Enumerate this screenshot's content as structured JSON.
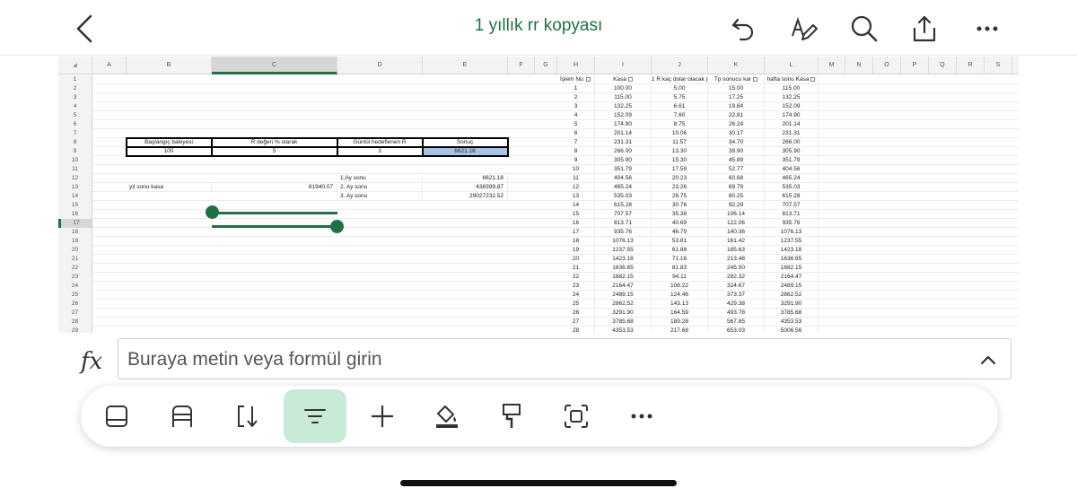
{
  "header": {
    "title": "1 yıllık rr kopyası",
    "back_icon": "chevron-left-icon",
    "undo_icon": "undo-icon",
    "pen_icon": "draw-pen-icon",
    "search_icon": "search-icon",
    "share_icon": "share-icon",
    "more_icon": "more-horizontal-icon"
  },
  "colors": {
    "accent": "#1e7145",
    "active_tool_bg": "#c9ead6",
    "highlight_cell": "#a8c3e8"
  },
  "sheet": {
    "corner": "◢",
    "columns": [
      "A",
      "B",
      "C",
      "D",
      "E",
      "F",
      "G",
      "H",
      "I",
      "J",
      "K",
      "L",
      "M",
      "N",
      "O",
      "P",
      "Q",
      "R",
      "S"
    ],
    "rows": [
      "1",
      "2",
      "3",
      "4",
      "5",
      "6",
      "7",
      "8",
      "9",
      "10",
      "11",
      "12",
      "13",
      "14",
      "15",
      "16",
      "17",
      "18",
      "19",
      "20",
      "21",
      "22",
      "23",
      "24",
      "25",
      "26",
      "27",
      "28",
      "29"
    ],
    "left_cells": {
      "b8": "Başlangıç bakiyesi",
      "c8": "R değeri % olarak",
      "d8": "Günlül hedeflenen R",
      "e8": "Sonuç",
      "b9": "100",
      "c9": "5",
      "d9": "3",
      "e9": "6621.18",
      "d12": "1.Ay sonu",
      "e12": "6621.18",
      "b13": "yıl sonu kasa",
      "c13": "81940.07",
      "d13": "2. Ay sonu",
      "e13": "438399.87",
      "d14": "3. Ay sonu",
      "e14": "29027232.52"
    },
    "table_headers": [
      "İşlem No:",
      "Kasa",
      "1 R kaç dolar olacak",
      "Tp sonucu kar",
      "hafta sonu Kasa"
    ],
    "table_rows": [
      [
        "1",
        "100.00",
        "5.00",
        "15.00",
        "115.00"
      ],
      [
        "2",
        "115.00",
        "5.75",
        "17.25",
        "132.25"
      ],
      [
        "3",
        "132.25",
        "6.61",
        "19.84",
        "152.09"
      ],
      [
        "4",
        "152.09",
        "7.60",
        "22.81",
        "174.90"
      ],
      [
        "5",
        "174.90",
        "8.75",
        "26.24",
        "201.14"
      ],
      [
        "6",
        "201.14",
        "10.06",
        "30.17",
        "231.31"
      ],
      [
        "7",
        "231.31",
        "11.57",
        "34.70",
        "266.00"
      ],
      [
        "8",
        "266.00",
        "13.30",
        "39.90",
        "305.90"
      ],
      [
        "9",
        "305.90",
        "15.30",
        "45.89",
        "351.79"
      ],
      [
        "10",
        "351.79",
        "17.59",
        "52.77",
        "404.56"
      ],
      [
        "11",
        "404.56",
        "20.23",
        "60.68",
        "465.24"
      ],
      [
        "12",
        "465.24",
        "23.26",
        "69.79",
        "535.03"
      ],
      [
        "13",
        "535.03",
        "26.75",
        "80.25",
        "615.28"
      ],
      [
        "14",
        "615.28",
        "30.76",
        "92.29",
        "707.57"
      ],
      [
        "15",
        "707.57",
        "35.38",
        "106.14",
        "813.71"
      ],
      [
        "16",
        "813.71",
        "40.69",
        "122.06",
        "935.76"
      ],
      [
        "17",
        "935.76",
        "46.79",
        "140.36",
        "1076.13"
      ],
      [
        "18",
        "1076.13",
        "53.81",
        "161.42",
        "1237.55"
      ],
      [
        "19",
        "1237.55",
        "61.88",
        "185.63",
        "1423.18"
      ],
      [
        "20",
        "1423.18",
        "71.16",
        "213.48",
        "1636.65"
      ],
      [
        "21",
        "1636.65",
        "81.83",
        "245.50",
        "1882.15"
      ],
      [
        "22",
        "1882.15",
        "94.11",
        "282.32",
        "2164.47"
      ],
      [
        "23",
        "2164.47",
        "108.22",
        "324.67",
        "2489.15"
      ],
      [
        "24",
        "2489.15",
        "124.46",
        "373.37",
        "2862.52"
      ],
      [
        "25",
        "2862.52",
        "143.13",
        "429.38",
        "3291.90"
      ],
      [
        "26",
        "3291.90",
        "164.59",
        "493.78",
        "3785.68"
      ],
      [
        "27",
        "3785.68",
        "189.28",
        "567.85",
        "4353.53"
      ],
      [
        "28",
        "4353.53",
        "217.68",
        "653.03",
        "5006.56"
      ]
    ]
  },
  "formula_bar": {
    "fx_label": "fx",
    "placeholder": "Buraya metin veya formül girin",
    "expand_icon": "chevron-up-icon"
  },
  "toolbar": {
    "tools": [
      {
        "icon": "freeze-panes-icon"
      },
      {
        "icon": "wrap-text-icon"
      },
      {
        "icon": "sort-icon"
      },
      {
        "icon": "filter-icon",
        "active": true
      },
      {
        "icon": "plus-icon"
      },
      {
        "icon": "fill-color-icon"
      },
      {
        "icon": "format-painter-icon"
      },
      {
        "icon": "select-range-icon"
      },
      {
        "icon": "more-horizontal-icon"
      }
    ]
  }
}
